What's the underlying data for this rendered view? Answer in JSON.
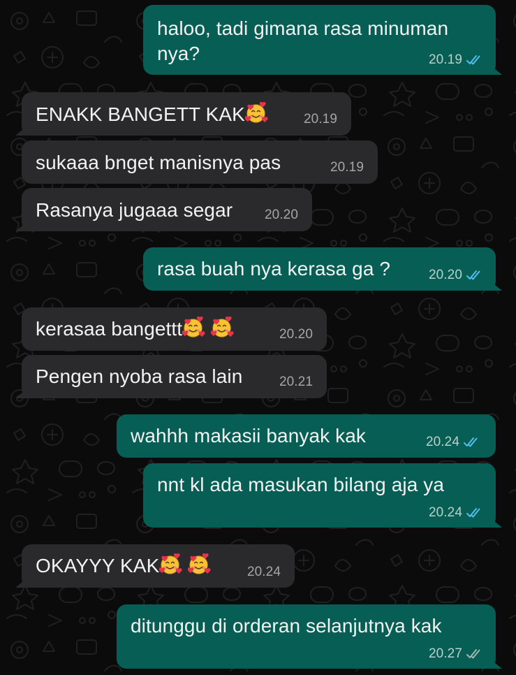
{
  "colors": {
    "background": "#0b0b0b",
    "incoming_bubble": "#2a2a2c",
    "outgoing_bubble": "#075e54",
    "read_receipt": "#53bdeb",
    "delivered_receipt": "#9fb7b3",
    "timestamp": "#a6a6a6",
    "text": "#f2f2f2"
  },
  "messages": [
    {
      "direction": "outgoing",
      "text": "haloo, tadi gimana rasa minuman\nnya?",
      "time": "20.19",
      "status": "read"
    },
    {
      "direction": "incoming",
      "text": "ENAKK BANGETT KAK",
      "emoji": "smiling-face-with-hearts",
      "time": "20.19"
    },
    {
      "direction": "incoming",
      "text": "sukaaa bnget manisnya pas",
      "time": "20.19"
    },
    {
      "direction": "incoming",
      "text": "Rasanya jugaaa segar",
      "time": "20.20"
    },
    {
      "direction": "outgoing",
      "text": "rasa buah nya kerasa ga ?",
      "time": "20.20",
      "status": "read"
    },
    {
      "direction": "incoming",
      "text": "kerasaa bangettt",
      "emoji": "smiling-face-with-hearts",
      "time": "20.20"
    },
    {
      "direction": "incoming",
      "text": "Pengen nyoba rasa lain",
      "time": "20.21"
    },
    {
      "direction": "outgoing",
      "text": "wahhh makasii banyak kak",
      "time": "20.24",
      "status": "read"
    },
    {
      "direction": "outgoing",
      "text": "nnt kl ada masukan bilang aja ya",
      "time": "20.24",
      "status": "read"
    },
    {
      "direction": "incoming",
      "text": "OKAYYY KAK",
      "emoji": "smiling-face-with-hearts",
      "time": "20.24"
    },
    {
      "direction": "outgoing",
      "text": "ditunggu di orderan selanjutnya kak",
      "time": "20.27",
      "status": "delivered"
    }
  ]
}
